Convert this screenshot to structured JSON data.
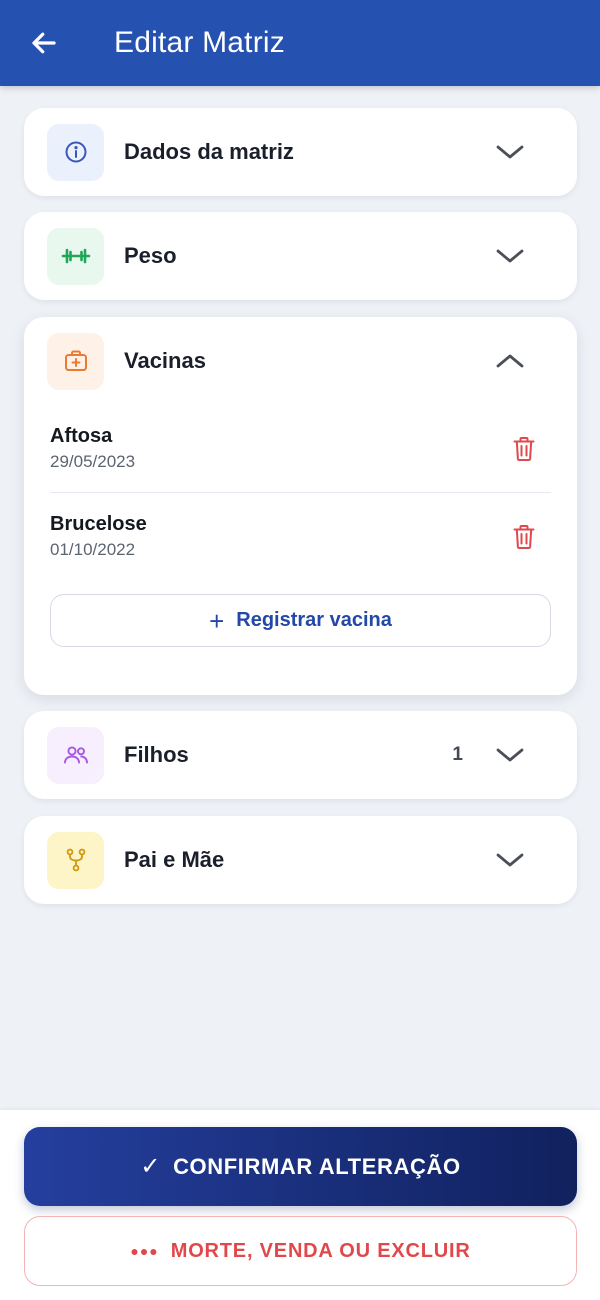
{
  "header": {
    "title": "Editar Matriz",
    "back_icon": "arrow-left-icon",
    "color": "#2552b0"
  },
  "sections": {
    "dados": {
      "title": "Dados da matriz",
      "icon": "info-icon",
      "icon_color": "#3a57b5",
      "icon_bg": "#eaf1fd",
      "expanded": false
    },
    "peso": {
      "title": "Peso",
      "icon": "dumbbell-icon",
      "icon_color": "#1fa657",
      "icon_bg": "#e9f8ef",
      "expanded": false
    },
    "vacinas": {
      "title": "Vacinas",
      "icon": "medical-kit-icon",
      "icon_color": "#ee7a2f",
      "icon_bg": "#fdf1e8",
      "expanded": true,
      "items": [
        {
          "name": "Aftosa",
          "date": "29/05/2023"
        },
        {
          "name": "Brucelose",
          "date": "01/10/2022"
        }
      ],
      "register_label": "Registrar vacina"
    },
    "filhos": {
      "title": "Filhos",
      "icon": "users-icon",
      "icon_color": "#a557e6",
      "icon_bg": "#f7eefe",
      "count": "1",
      "expanded": false
    },
    "pais": {
      "title": "Pai e Mãe",
      "icon": "branch-icon",
      "icon_color": "#d49a12",
      "icon_bg": "#fdf5c8",
      "expanded": false
    }
  },
  "actions": {
    "confirm_label": "CONFIRMAR ALTERAÇÃO",
    "danger_label": "MORTE, VENDA OU EXCLUIR",
    "danger_color": "#e0484b"
  }
}
